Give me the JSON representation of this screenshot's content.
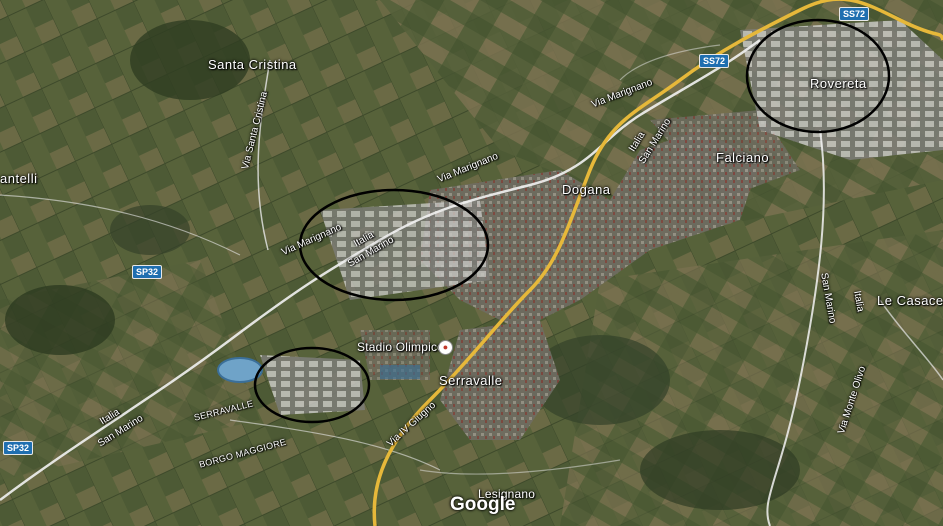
{
  "map": {
    "places": {
      "santa_cristina": "Santa Cristina",
      "cantelli": "antelli",
      "dogana": "Dogana",
      "falciano": "Falciano",
      "rovereta": "Rovereta",
      "serravalle": "Serravalle",
      "lesignano": "Lesignano",
      "le_casace": "Le Casace",
      "serravalle_caps": "SERRAVALLE",
      "borgo_maggiore_caps": "BORGO MAGGIORE"
    },
    "poi": {
      "stadio_olimpico": "Stadio Olimpico"
    },
    "streets": {
      "via_santa_cristina": "Via Santa Cristina",
      "via_marignano_top": "Via Marignano",
      "via_marignano_mid": "Via Marignano",
      "via_marignano_left": "Via Marignano",
      "via_iv_giugno": "Via IV Giugno",
      "via_monte_olivo": "Via Monte Olivo"
    },
    "border_labels": {
      "italia_center": "Italia",
      "san_marino_center": "San Marino",
      "italia_top": "Italia",
      "san_marino_top": "San Marino",
      "san_marino_right": "San Marino",
      "italia_right": "Italia",
      "italia_left": "Italia",
      "san_marino_left": "San Marino"
    },
    "shields": {
      "ss72_top": "SS72",
      "ss72_mid": "SS72",
      "sp32_a": "SP32",
      "sp32_b": "SP32"
    },
    "attribution": "Google",
    "highlight_circles": [
      "ellipse-marignano-area",
      "ellipse-serravalle-industrial",
      "ellipse-rovereta"
    ],
    "colors": {
      "road_main": "#e6b83a",
      "road_secondary": "#ffffff",
      "shield": "#1f6fb0",
      "circle": "#000000"
    }
  }
}
